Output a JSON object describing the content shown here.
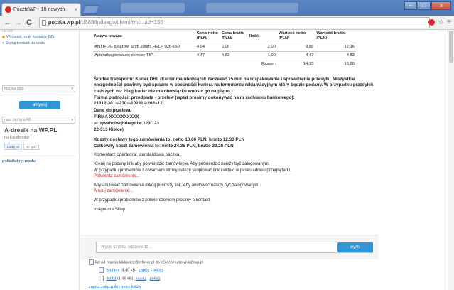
{
  "browser": {
    "tab_title": "PocztaWP - 10 nowych",
    "tab_close": "×",
    "url_host": "poczta.wp.pl",
    "url_path": "/d688/indexgwt.html#md.uid=156",
    "back": "←",
    "forward": "→",
    "reload": "C",
    "star": "☆",
    "menu": "≡",
    "min": "–",
    "max": "□",
    "close": "x"
  },
  "left_panel": {
    "cut_top": "ne ooo",
    "gg_link": "Wyświetl moje kontakty GG",
    "add_contact": "+ Dodaj kontakt do czatu",
    "select1": "bramka sms",
    "activate_btn": "aktywuj",
    "select2": "nasz profil na FB",
    "promo_title": "A-dresik na WP.PL",
    "promo_sub": "na Facebooku",
    "fb_like": "Lubię to!",
    "fb_count": "57 tys.",
    "hide_module": "pokaż/ukryj moduł",
    "arrow": "▾"
  },
  "order_table": {
    "headers": [
      "Nazwa towaru",
      "Cena netto\n/PLN/",
      "Cena brutto\n/PLN/",
      "Ilość",
      "Wartość netto\n/PLN/",
      "Wartość brutto\n/PLN/"
    ],
    "rows": [
      [
        "ANTIFOG p/parow. szyb 200ml HELP 026-160",
        "4.94",
        "6.08",
        "2.00",
        "9.88",
        "12.16"
      ],
      [
        "Apteczka pierwszej pomocy TIP .",
        "4.47",
        "4.83",
        "1.00",
        "4.47",
        "4.83"
      ]
    ],
    "sum_label": "Razem:",
    "sum_netto": "14.35",
    "sum_brutto": "16.98"
  },
  "message": {
    "transport": "Środek transportu: Kurier DHL (Kurier ma obowiązek zaczekać 15 min na rozpakowanie i sprawdzenie przesyłki. Wszystkie niezgodności powinny być spisane w obecności kuriera na formularzu reklamacyjnym który będzie podany. W przypadku przesyłek cięższych niż 20kg kurier nie ma obowiązku wnosić go na piętro.)",
    "payment": "Forma płatności: przedpłata - przelew (wpłat prosimy dokonywać na nr rachunku bankowego):",
    "account": "21312-301-=230=-10231=-203=12",
    "transfer_label": "Dane do przelewu",
    "company": "FIRMA XXXXXXXXXX",
    "street": "ul. qwehotwqhdeqndw 123/123",
    "city": "22-313 Kielce)",
    "delivery_cost": "Koszty dostawy tego zamówienia to: netto 10.00 PLN, brutto 12.30 PLN",
    "total_cost": "Całkowity koszt zamówienia to: netto 24.35 PLN, brutto 29.28 PLN",
    "operator_comment": "Komentarz operatora: standardowa paczka",
    "confirm_line": "Kliknij na podany link aby potwierdzić zamówienie. Aby potwierdzić należy być zalogowanym.",
    "problem_line": "W przypadku problemów z otwarciem strony należy skopiować link i wkleić w pasku adresu przeglądarki.",
    "confirm_link": "Potwierdź zamówienie...",
    "cancel_line": "Aby anulować zamówienie kliknij poniższy link. Aby anulować należy być zalogowanym.",
    "cancel_link": "Anuluj zamówienie...",
    "contact_line": "W przypadku problemów z potwierdzeniem prosimy o kontakt.",
    "signature": "Insignum eSklep"
  },
  "reply": {
    "placeholder": "Wyślij szybką odpowiedź ...",
    "send": "wyślij"
  },
  "attachments": {
    "header": "list od marcin.kiklowicz@infover.pl do eSklepHurtownik@wp.pl",
    "files": [
      {
        "name": "list.html",
        "size": "(4.40 kB)",
        "save": "zapisz",
        "sep": "|",
        "show": "pokaż"
      },
      {
        "name": "list.txt",
        "size": "(1.49 kB)",
        "save": "zapisz",
        "sep": "|",
        "show": "pokaż"
      }
    ],
    "save_all": "zapisz załączniki i treści listów"
  }
}
